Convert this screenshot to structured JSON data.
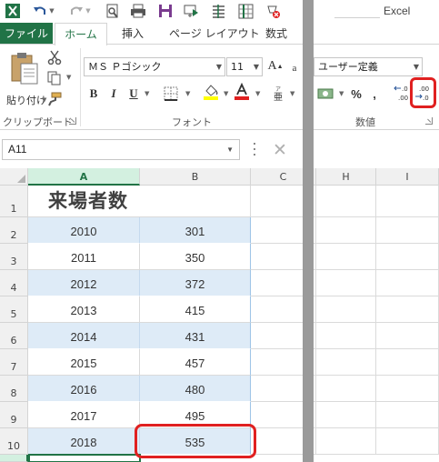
{
  "window": {
    "app_title": "Excel"
  },
  "tabs": [
    {
      "label": "ファイル"
    },
    {
      "label": "ホーム"
    },
    {
      "label": "挿入"
    },
    {
      "label": "ページ レイアウト"
    },
    {
      "label": "数式"
    }
  ],
  "ribbon": {
    "clipboard": {
      "paste_label": "貼り付け",
      "group_label": "クリップボード"
    },
    "font": {
      "font_name": "ＭＳ Ｐゴシック",
      "font_size": "11",
      "bold": "B",
      "italic": "I",
      "underline": "U",
      "group_label": "フォント"
    },
    "number": {
      "format_value": "ユーザー定義",
      "percent": "%",
      "comma": ",",
      "group_label": "数値"
    }
  },
  "formula_bar": {
    "name_box": "A11"
  },
  "sheet": {
    "columns": [
      "A",
      "B",
      "C",
      "H",
      "I"
    ],
    "rows": [
      "1",
      "2",
      "3",
      "4",
      "5",
      "6",
      "7",
      "8",
      "9",
      "10"
    ],
    "title": "来場者数",
    "data": [
      {
        "year": "2010",
        "value": "301"
      },
      {
        "year": "2011",
        "value": "350"
      },
      {
        "year": "2012",
        "value": "372"
      },
      {
        "year": "2013",
        "value": "415"
      },
      {
        "year": "2014",
        "value": "431"
      },
      {
        "year": "2015",
        "value": "457"
      },
      {
        "year": "2016",
        "value": "480"
      },
      {
        "year": "2017",
        "value": "495"
      },
      {
        "year": "2018",
        "value": "535"
      }
    ]
  },
  "colors": {
    "excel_green": "#217346",
    "highlight_red": "#e02020",
    "band_blue": "#deebf7"
  }
}
